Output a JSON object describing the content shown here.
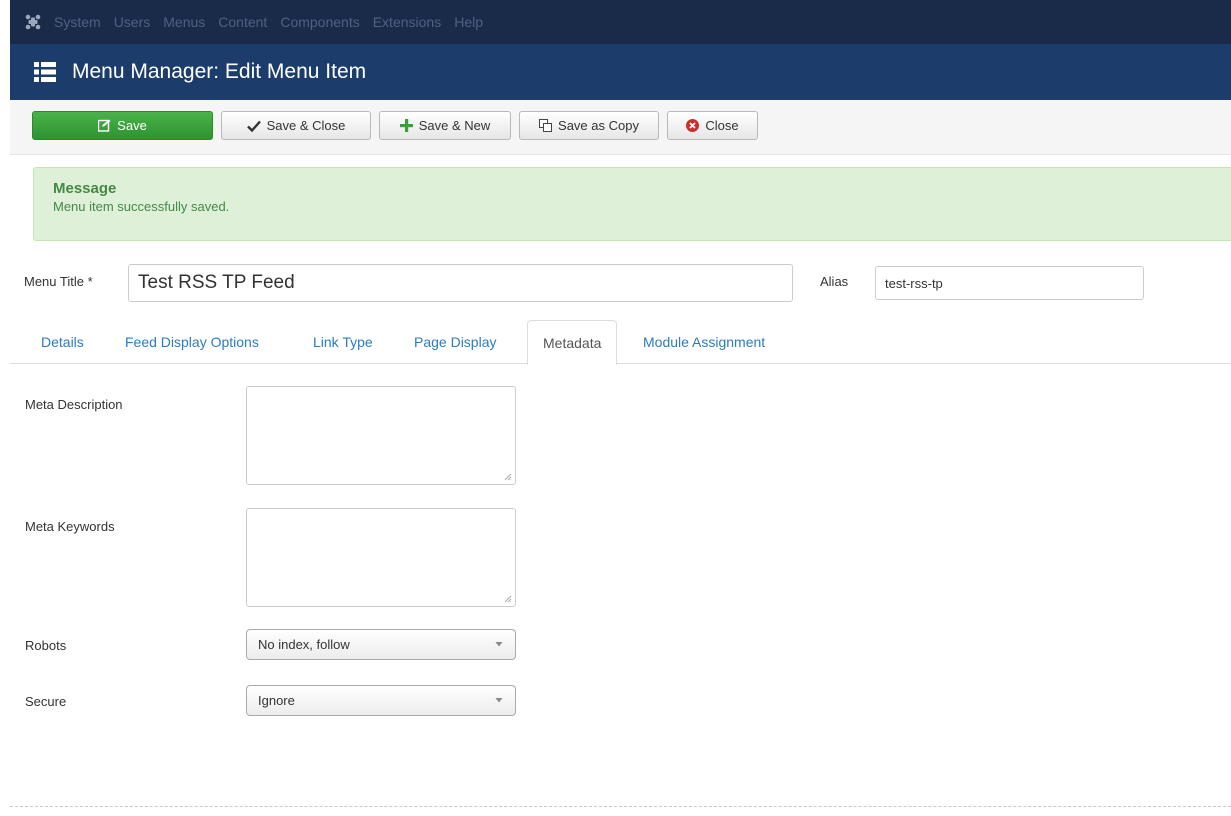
{
  "topbar": {
    "logo_icon": "joomla-logo-icon",
    "menu": [
      "System",
      "Users",
      "Menus",
      "Content",
      "Components",
      "Extensions",
      "Help"
    ]
  },
  "header": {
    "icon": "list-menu-icon",
    "title": "Menu Manager: Edit Menu Item"
  },
  "toolbar": {
    "save_label": "Save",
    "save_close_label": "Save & Close",
    "save_new_label": "Save & New",
    "save_copy_label": "Save as Copy",
    "close_label": "Close"
  },
  "alert": {
    "heading": "Message",
    "body": "Menu item successfully saved."
  },
  "form": {
    "title_label": "Menu Title *",
    "title_value": "Test RSS TP Feed",
    "alias_label": "Alias",
    "alias_value": "test-rss-tp"
  },
  "tabs": [
    {
      "label": "Details"
    },
    {
      "label": "Feed Display Options"
    },
    {
      "label": "Link Type"
    },
    {
      "label": "Page Display"
    },
    {
      "label": "Metadata"
    },
    {
      "label": "Module Assignment"
    }
  ],
  "active_tab": "Metadata",
  "metadata": {
    "meta_description_label": "Meta Description",
    "meta_description_value": "",
    "meta_keywords_label": "Meta Keywords",
    "meta_keywords_value": "",
    "robots_label": "Robots",
    "robots_value": "No index, follow",
    "secure_label": "Secure",
    "secure_value": "Ignore"
  },
  "colors": {
    "topbar_bg": "#1a2b4a",
    "header_bg": "#1c3d6c",
    "save_green": "#3a9f3a",
    "alert_bg": "#dff0d8",
    "alert_text": "#468847",
    "link_blue": "#2b7cc1",
    "close_red": "#c9302c"
  }
}
